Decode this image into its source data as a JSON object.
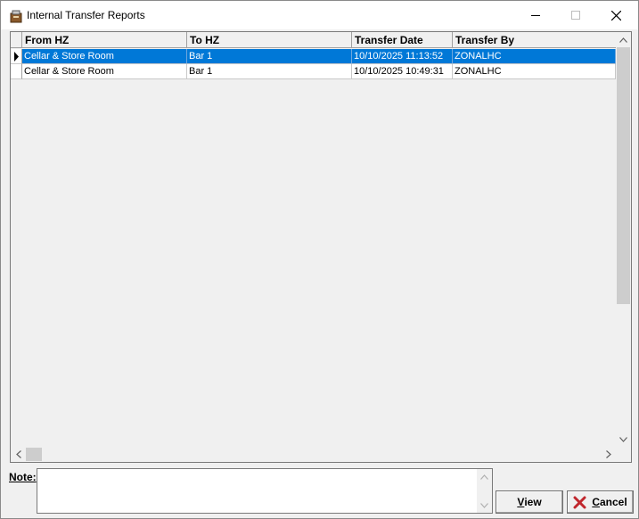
{
  "window": {
    "title": "Internal Transfer Reports"
  },
  "grid": {
    "columns": [
      "From HZ",
      "To HZ",
      "Transfer Date",
      "Transfer By"
    ],
    "rows": [
      [
        "Cellar & Store Room",
        "Bar 1",
        "10/10/2025 11:13:52",
        "ZONALHC"
      ],
      [
        "Cellar & Store Room",
        "Bar 1",
        "10/10/2025 10:49:31",
        "ZONALHC"
      ]
    ],
    "selected_row": 0
  },
  "note": {
    "label": "Note:",
    "value": ""
  },
  "buttons": {
    "view": {
      "label_u": "V",
      "label_rest": "iew"
    },
    "cancel": {
      "label_u": "C",
      "label_rest": "ancel"
    }
  },
  "colors": {
    "selection": "#0078d7",
    "cancel_icon": "#c0272d"
  },
  "icons": {
    "app": "report-app-icon",
    "row_pointer": "row-pointer-icon",
    "cancel": "red-x-icon"
  }
}
